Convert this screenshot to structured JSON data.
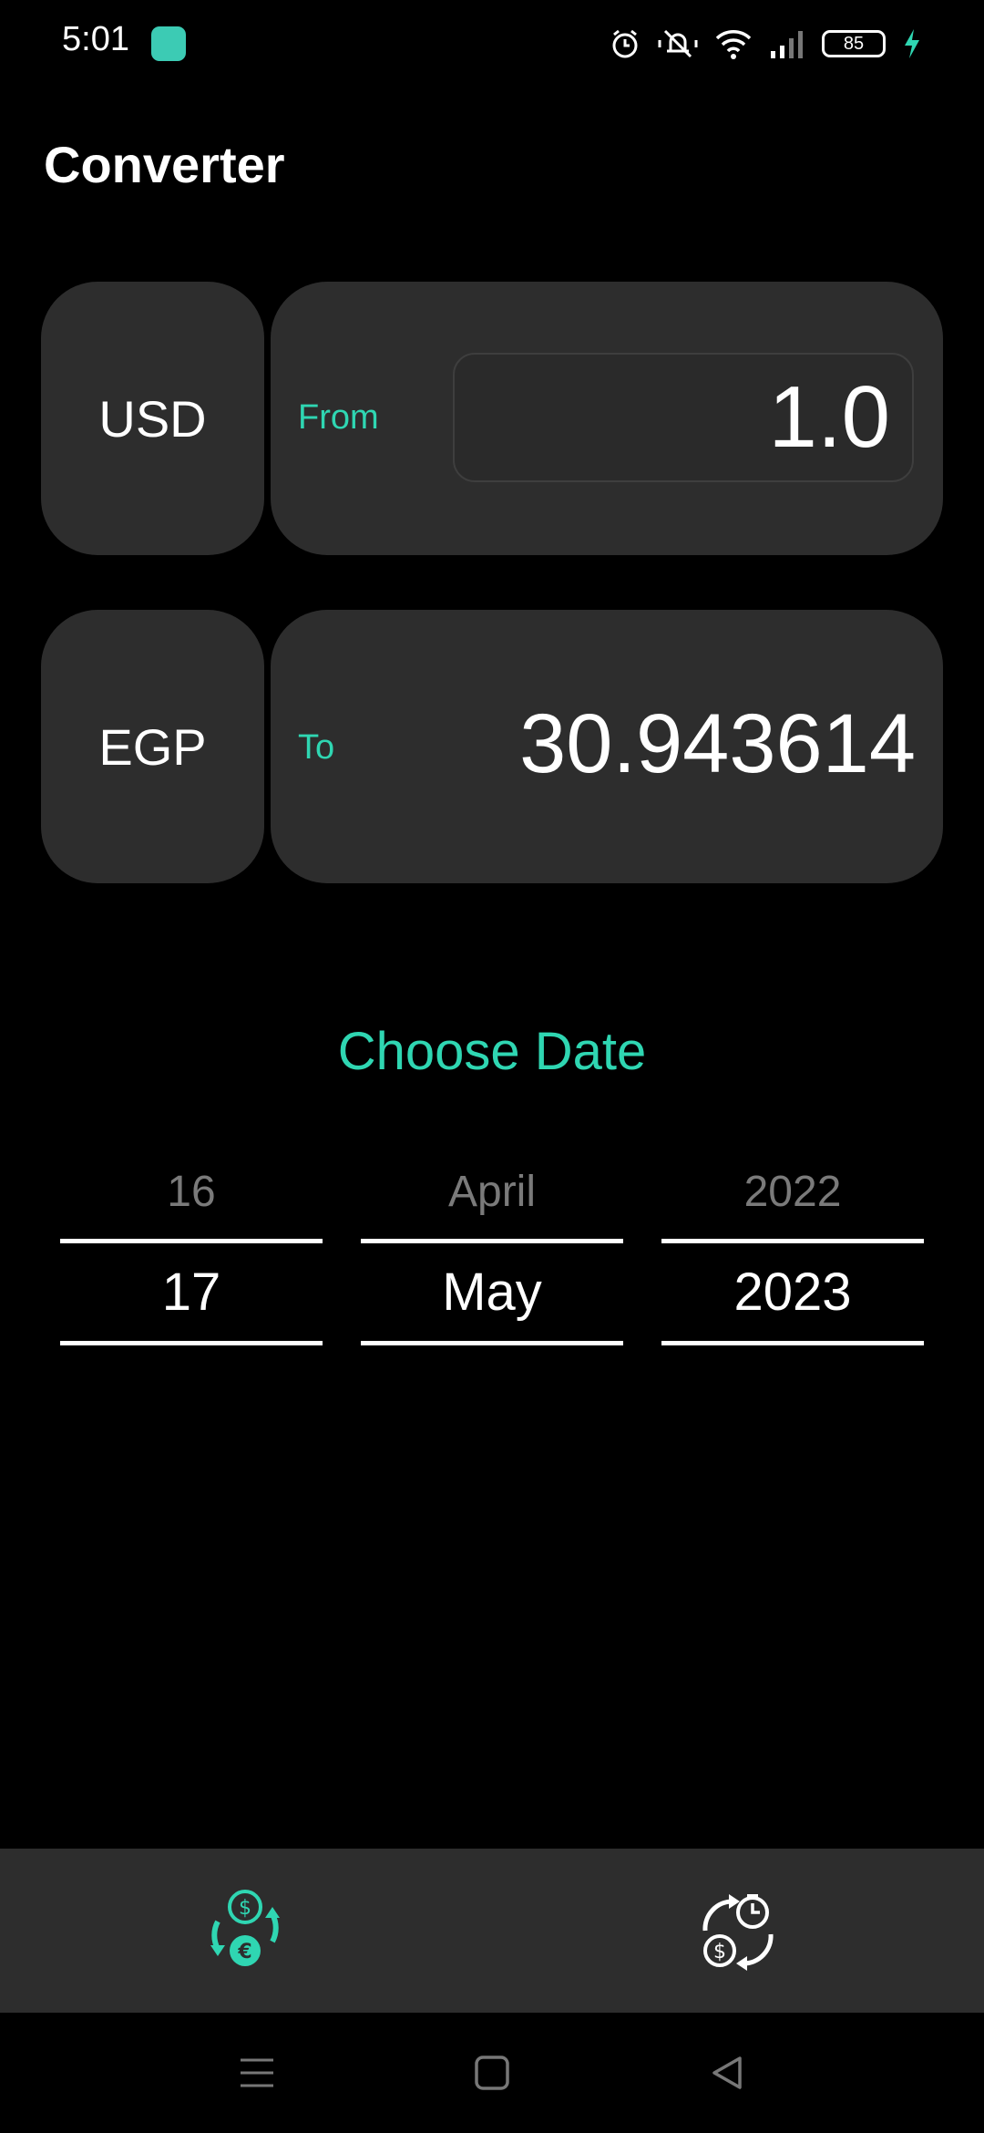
{
  "status_bar": {
    "time": "5:01",
    "battery": "85",
    "icons": [
      "alarm-icon",
      "muted-bell-icon",
      "wifi-icon",
      "signal-icon",
      "battery-icon",
      "charging-icon"
    ]
  },
  "header": {
    "title": "Converter"
  },
  "converter": {
    "from_currency": "USD",
    "from_label": "From",
    "from_value": "1.0",
    "to_currency": "EGP",
    "to_label": "To",
    "to_value": "30.943614"
  },
  "date_section": {
    "title": "Choose Date"
  },
  "date_picker": {
    "day": {
      "prev": "16",
      "current": "17"
    },
    "month": {
      "prev": "April",
      "current": "May"
    },
    "year": {
      "prev": "2022",
      "current": "2023"
    }
  },
  "bottom_nav": {
    "items": [
      {
        "icon": "currency-exchange-icon",
        "active": true
      },
      {
        "icon": "history-exchange-icon",
        "active": false
      }
    ]
  },
  "colors": {
    "accent": "#2fd6b2",
    "card": "#2d2d2d",
    "background": "#000000"
  }
}
